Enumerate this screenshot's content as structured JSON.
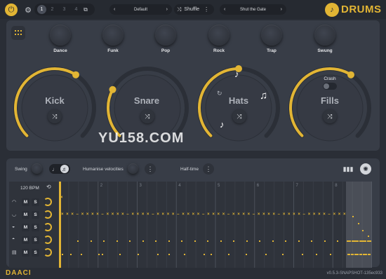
{
  "topbar": {
    "pattern_numbers": [
      "1",
      "2",
      "3",
      "4"
    ],
    "preset_left": "Default",
    "shuffle_label": "Shuffle",
    "preset_right": "Shut the Gate",
    "brand": "DRUMS"
  },
  "knobs": [
    {
      "label": "Dance"
    },
    {
      "label": "Funk"
    },
    {
      "label": "Pop"
    },
    {
      "label": "Rock"
    },
    {
      "label": "Trap"
    },
    {
      "label": "Swung"
    }
  ],
  "big_controls": [
    {
      "label": "Kick",
      "level": 0.62
    },
    {
      "label": "Snare",
      "level": 0.27
    },
    {
      "label": "Hats",
      "level": 0.5
    },
    {
      "label": "Fills",
      "level": 0.62
    }
  ],
  "crash_label": "Crash",
  "bottom_bar": {
    "swing_label": "Swing",
    "humanise_label": "Humanise velocities",
    "halftime_label": "Half-time"
  },
  "sequencer": {
    "bpm": "120 BPM",
    "bar_numbers": [
      "2",
      "3",
      "4",
      "5",
      "6",
      "7",
      "8"
    ],
    "track_buttons": {
      "mute": "M",
      "solo": "S"
    },
    "tracks": [
      "hats",
      "hats2",
      "snare",
      "kick",
      "cymbal"
    ]
  },
  "footer": {
    "logo": "DAACI",
    "version": "v0.5.3-SNAPSHOT-135ec933"
  },
  "colors": {
    "accent": "#e2b534",
    "background": "#2a2e36",
    "panel": "#383d47"
  }
}
